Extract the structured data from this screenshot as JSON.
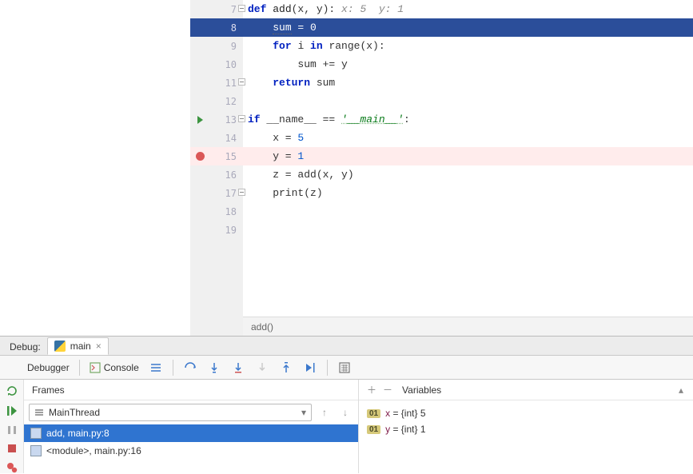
{
  "editor": {
    "inline_hints": " x: 5  y: 1",
    "lines": [
      {
        "n": 7,
        "code_html": "<span class='kw'>def </span><span class='fn'>add</span>(x, y):",
        "fold": true
      },
      {
        "n": 8,
        "code_html": "    <span class='underline'>sum</span> = 0",
        "exec": true
      },
      {
        "n": 9,
        "code_html": "    <span class='kw'>for </span>i <span class='kw'>in </span>range(x):"
      },
      {
        "n": 10,
        "code_html": "        sum += y"
      },
      {
        "n": 11,
        "code_html": "    <span class='kw'>return </span>sum",
        "foldend": true
      },
      {
        "n": 12,
        "code_html": ""
      },
      {
        "n": 13,
        "code_html": "<span class='kw'>if </span>__name__ == <span class='str'>'__main__'</span>:",
        "run": true,
        "fold": true
      },
      {
        "n": 14,
        "code_html": "    x = <span class='num'>5</span>"
      },
      {
        "n": 15,
        "code_html": "    y = <span class='num'>1</span>",
        "bp": true,
        "bprow": true
      },
      {
        "n": 16,
        "code_html": "    z = add(x, y)"
      },
      {
        "n": 17,
        "code_html": "    print(z)",
        "foldend": true
      },
      {
        "n": 18,
        "code_html": ""
      },
      {
        "n": 19,
        "code_html": ""
      }
    ],
    "breadcrumb": "add()"
  },
  "debug": {
    "label": "Debug:",
    "tab": "main",
    "toolbar": {
      "debugger": "Debugger",
      "console": "Console"
    },
    "frames": {
      "title": "Frames",
      "thread": "MainThread",
      "items": [
        {
          "label": "add, main.py:8",
          "selected": true
        },
        {
          "label": "<module>, main.py:16",
          "selected": false
        }
      ]
    },
    "variables": {
      "title": "Variables",
      "items": [
        {
          "badge": "01",
          "name": "x",
          "rest": " = {int} 5"
        },
        {
          "badge": "01",
          "name": "y",
          "rest": " = {int} 1"
        }
      ]
    }
  }
}
